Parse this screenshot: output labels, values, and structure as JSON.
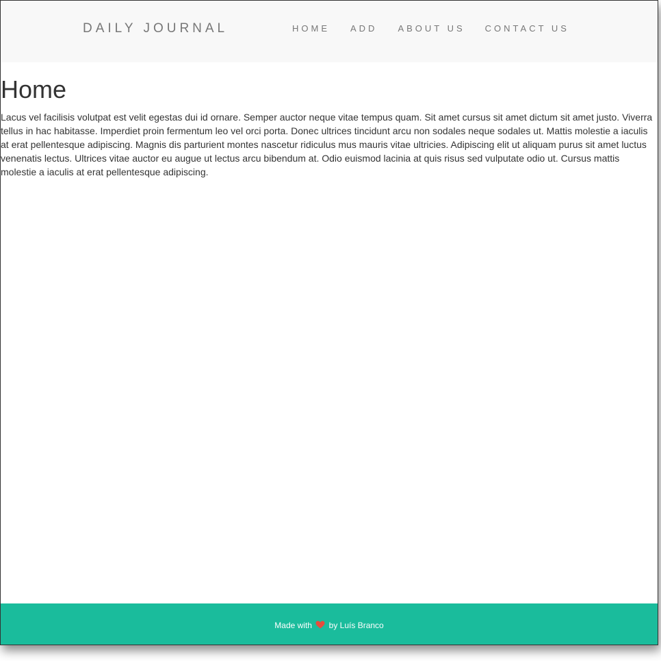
{
  "navbar": {
    "brand": "DAILY JOURNAL",
    "items": [
      {
        "label": "HOME"
      },
      {
        "label": "ADD"
      },
      {
        "label": "ABOUT US"
      },
      {
        "label": "CONTACT US"
      }
    ]
  },
  "main": {
    "title": "Home",
    "paragraph": "Lacus vel facilisis volutpat est velit egestas dui id ornare. Semper auctor neque vitae tempus quam. Sit amet cursus sit amet dictum sit amet justo. Viverra tellus in hac habitasse. Imperdiet proin fermentum leo vel orci porta. Donec ultrices tincidunt arcu non sodales neque sodales ut. Mattis molestie a iaculis at erat pellentesque adipiscing. Magnis dis parturient montes nascetur ridiculus mus mauris vitae ultricies. Adipiscing elit ut aliquam purus sit amet luctus venenatis lectus. Ultrices vitae auctor eu augue ut lectus arcu bibendum at. Odio euismod lacinia at quis risus sed vulputate odio ut. Cursus mattis molestie a iaculis at erat pellentesque adipiscing."
  },
  "footer": {
    "prefix": "Made with",
    "icon": "heart-icon",
    "suffix": "by Luís Branco"
  },
  "colors": {
    "navbar_bg": "#f8f8f8",
    "footer_bg": "#1abc9c",
    "heart": "#e74c3c",
    "text": "#333333",
    "nav_text": "#777777"
  }
}
